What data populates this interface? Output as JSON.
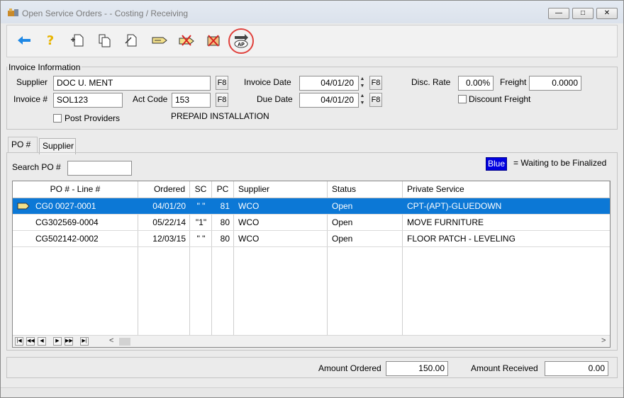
{
  "window": {
    "title": "Open Service Orders - - Costing / Receiving",
    "controls": {
      "minimize": "—",
      "restore": "□",
      "close": "✕"
    }
  },
  "toolbar": {
    "buttons": [
      {
        "name": "back-icon",
        "glyph": "←",
        "color": "#1e88e5"
      },
      {
        "name": "help-icon",
        "glyph": "?",
        "color": "#e8b400"
      },
      {
        "name": "new-document-icon",
        "glyph": ""
      },
      {
        "name": "copy-document-icon",
        "glyph": ""
      },
      {
        "name": "edit-document-icon",
        "glyph": ""
      },
      {
        "name": "tag-icon",
        "glyph": ""
      },
      {
        "name": "delete-tag-icon",
        "glyph": ""
      },
      {
        "name": "delete-record-icon",
        "glyph": ""
      },
      {
        "name": "ap-transfer-icon",
        "glyph": "AP"
      }
    ]
  },
  "invoice": {
    "legend": "Invoice Information",
    "supplier_label": "Supplier",
    "supplier_value": "DOC U. MENT",
    "invoice_label": "Invoice #",
    "invoice_value": "SOL123",
    "actcode_label": "Act Code",
    "actcode_value": "153",
    "invoice_date_label": "Invoice Date",
    "invoice_date_value": "04/01/20",
    "due_date_label": "Due Date",
    "due_date_value": "04/01/20",
    "disc_rate_label": "Disc. Rate",
    "disc_rate_value": "0.00%",
    "freight_label": "Freight",
    "freight_value": "0.0000",
    "discount_freight_label": "Discount Freight",
    "post_providers_label": "Post Providers",
    "f8_label": "F8",
    "description": "PREPAID INSTALLATION"
  },
  "tabs": [
    {
      "label": "PO #",
      "active": true
    },
    {
      "label": "Supplier",
      "active": false
    }
  ],
  "search": {
    "label": "Search PO #",
    "value": ""
  },
  "legend": {
    "swatch_label": "Blue",
    "text": "= Waiting to be Finalized",
    "color": "#0000e0"
  },
  "grid": {
    "columns": [
      "PO # - Line #",
      "Ordered",
      "SC",
      "PC",
      "Supplier",
      "Status",
      "Private Service"
    ],
    "rows": [
      {
        "po": "CG0 0027-0001",
        "ordered": "04/01/20",
        "sc": "\" \"",
        "pc": "81",
        "supplier": "WCO",
        "status": "Open",
        "service": "CPT-(APT)-GLUEDOWN",
        "selected": true
      },
      {
        "po": "CG302569-0004",
        "ordered": "05/22/14",
        "sc": "\"1\"",
        "pc": "80",
        "supplier": "WCO",
        "status": "Open",
        "service": "MOVE FURNITURE",
        "selected": false
      },
      {
        "po": "CG502142-0002",
        "ordered": "12/03/15",
        "sc": "\" \"",
        "pc": "80",
        "supplier": "WCO",
        "status": "Open",
        "service": "FLOOR PATCH - LEVELING",
        "selected": false
      }
    ],
    "nav": {
      "first": "|◀",
      "prev_page": "◀◀",
      "prev": "◀",
      "next": "▶",
      "next_page": "▶▶",
      "last": "▶|",
      "scroll_left": "<",
      "scroll_right": ">"
    }
  },
  "totals": {
    "ordered_label": "Amount Ordered",
    "ordered_value": "150.00",
    "received_label": "Amount Received",
    "received_value": "0.00"
  }
}
